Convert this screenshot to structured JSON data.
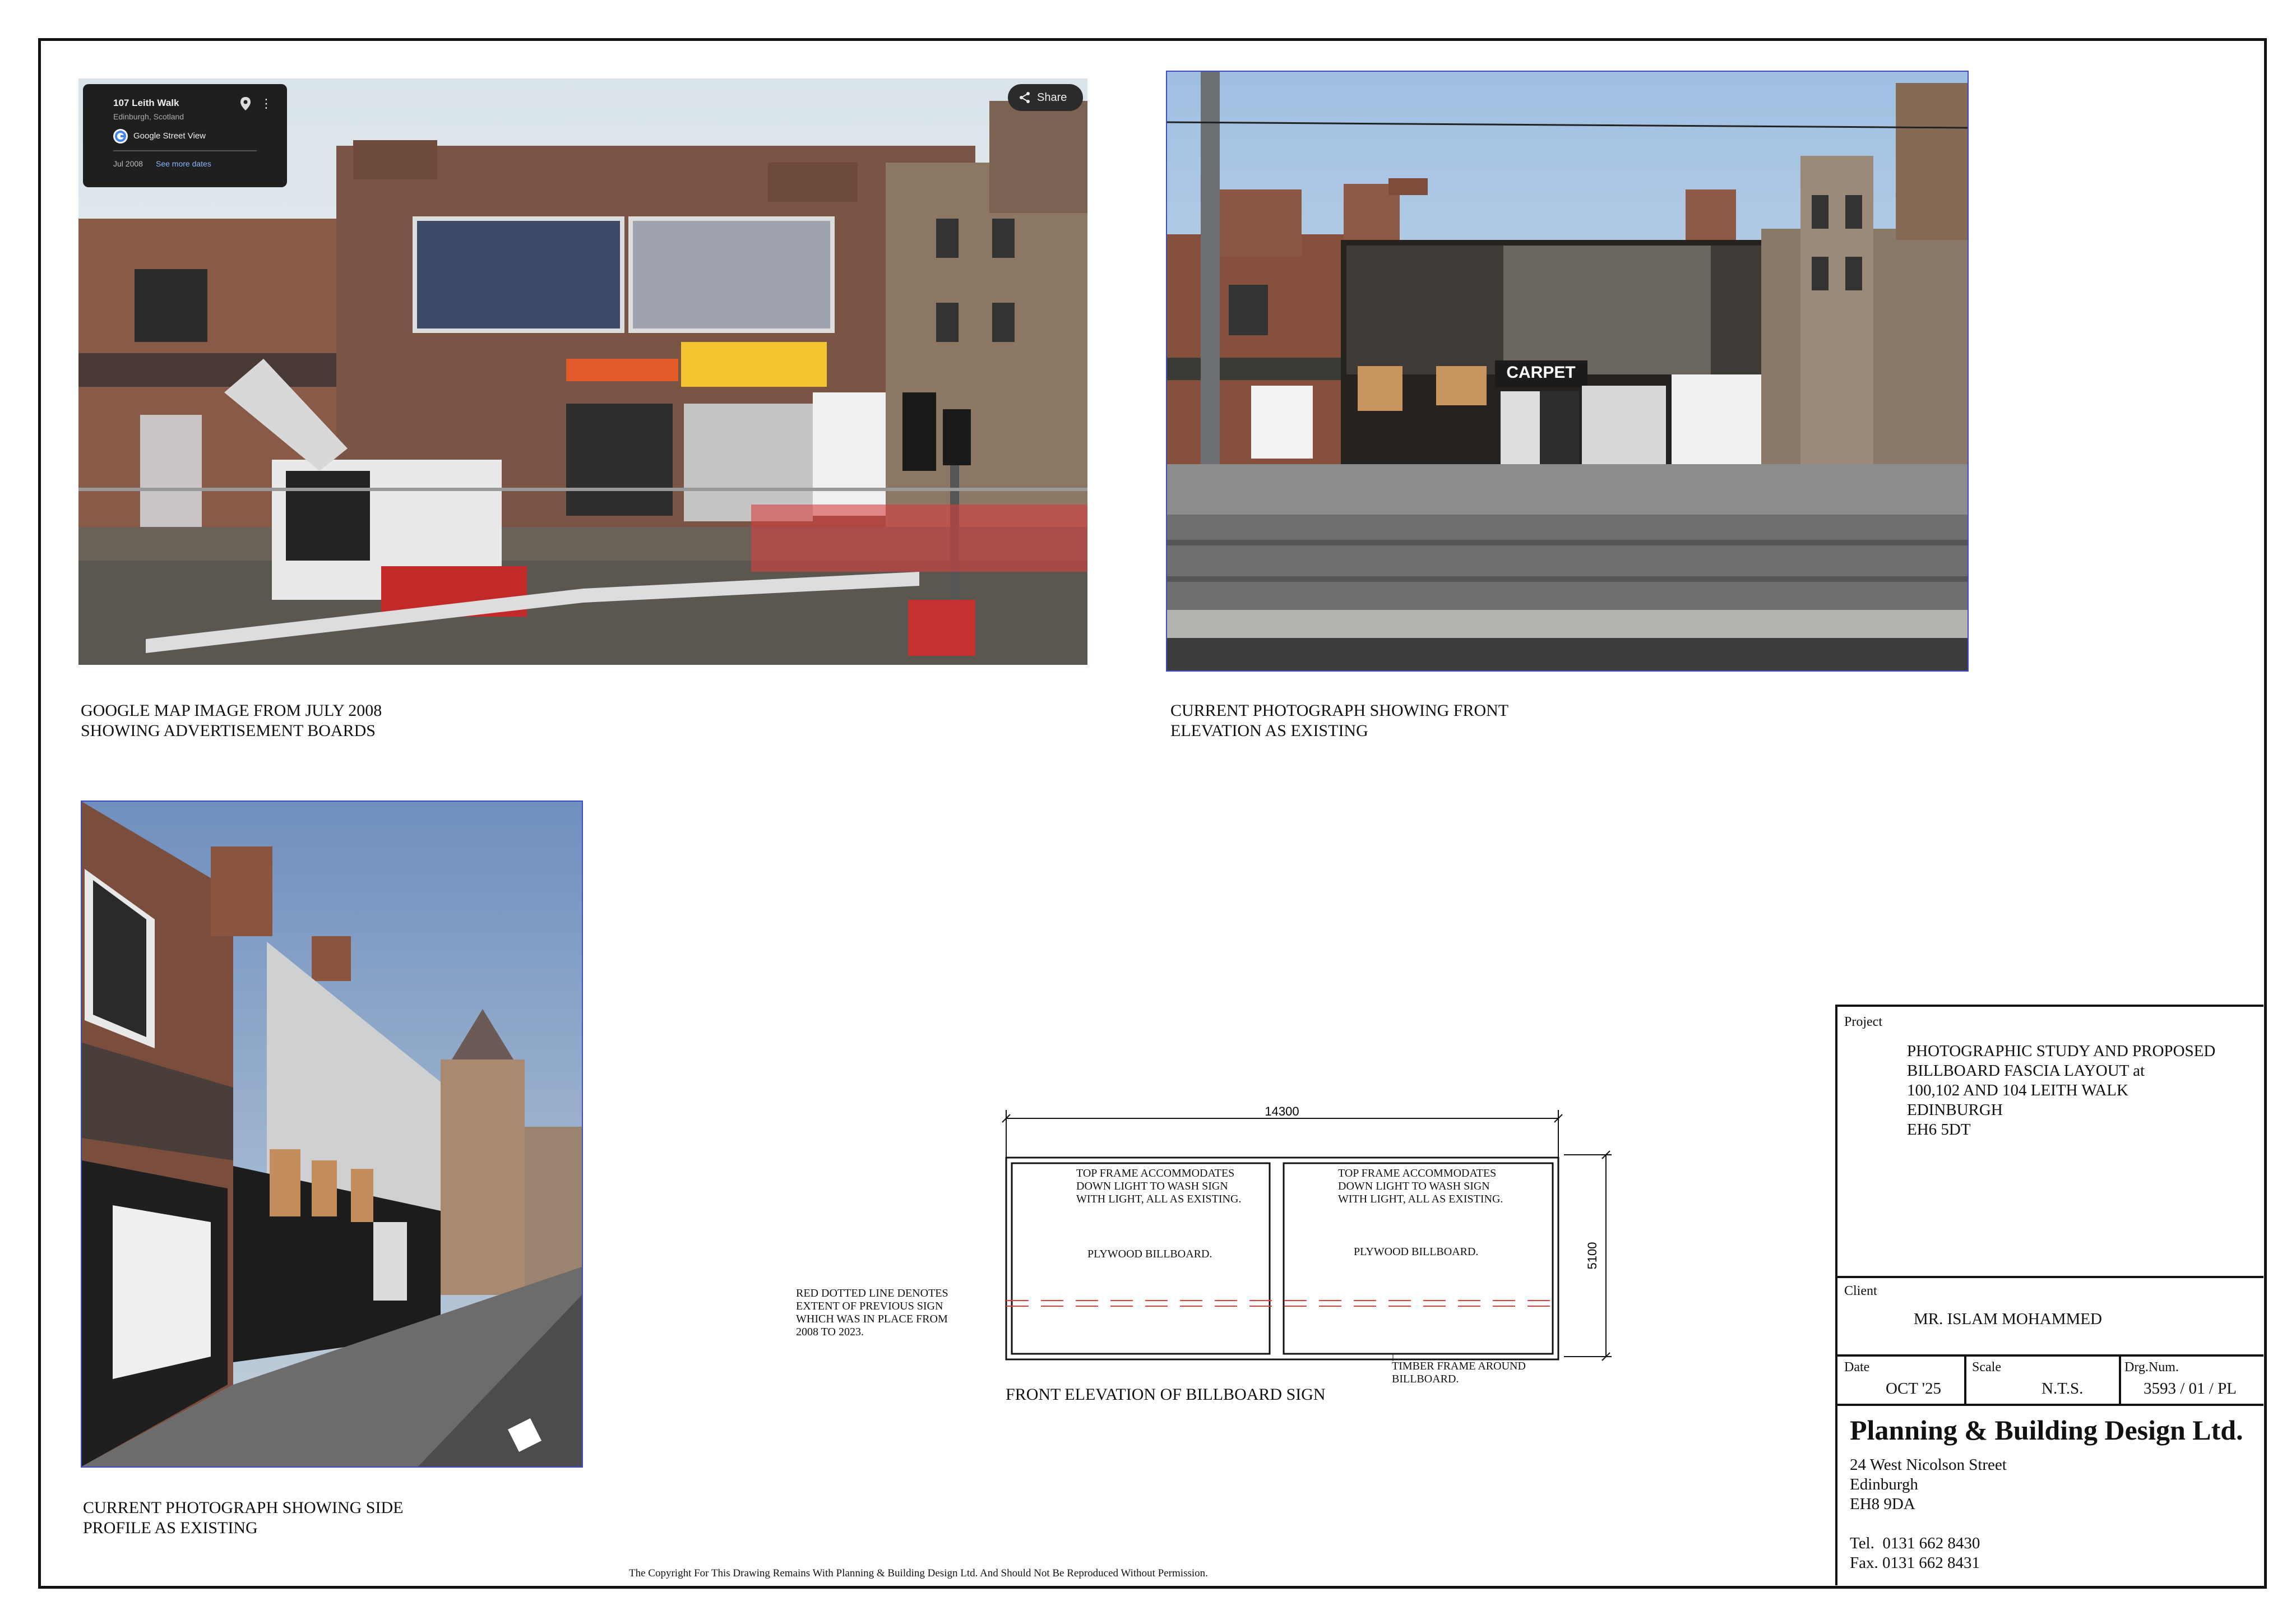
{
  "captions": {
    "google_map": "GOOGLE MAP IMAGE FROM JULY 2008\nSHOWING ADVERTISEMENT BOARDS",
    "front_photo": "CURRENT PHOTOGRAPH SHOWING FRONT\nELEVATION AS EXISTING",
    "side_photo": "CURRENT PHOTOGRAPH SHOWING SIDE\nPROFILE AS EXISTING",
    "elevation": "FRONT ELEVATION OF BILLBOARD SIGN"
  },
  "streetview_overlay": {
    "place": "107 Leith Walk",
    "subtitle": "Edinburgh, Scotland",
    "source": "Google Street View",
    "date_label": "Jul 2008",
    "see_more": "See more dates",
    "share": "Share"
  },
  "photo_signs": {
    "carpet": "CARPET"
  },
  "drawing": {
    "width_dim": "14300",
    "height_dim": "5100",
    "panel_left_note": "TOP FRAME ACCOMMODATES\nDOWN LIGHT TO WASH SIGN\nWITH LIGHT, ALL AS EXISTING.",
    "panel_right_note": "TOP FRAME ACCOMMODATES\nDOWN LIGHT TO WASH SIGN\nWITH LIGHT, ALL AS EXISTING.",
    "panel_left_label": "PLYWOOD BILLBOARD.",
    "panel_right_label": "PLYWOOD BILLBOARD.",
    "red_line_note": "RED DOTTED LINE DENOTES\nEXTENT OF PREVIOUS SIGN\nWHICH WAS IN PLACE FROM\n2008 TO 2023.",
    "timber_note": "TIMBER FRAME AROUND\nBILLBOARD.",
    "red_line_color": "#e0403c"
  },
  "title_block": {
    "project_label": "Project",
    "project": "PHOTOGRAPHIC STUDY AND PROPOSED\nBILLBOARD FASCIA LAYOUT at\n100,102 AND 104 LEITH WALK\nEDINBURGH\nEH6 5DT",
    "client_label": "Client",
    "client": "MR. ISLAM MOHAMMED",
    "date_label": "Date",
    "date": "OCT '25",
    "scale_label": "Scale",
    "scale": "N.T.S.",
    "drg_label": "Drg.Num.",
    "drg": "3593 / 01 / PL",
    "company": "Planning & Building Design Ltd.",
    "address": "24 West Nicolson Street\nEdinburgh\nEH8 9DA",
    "tel": "Tel.  0131 662 8430",
    "fax": "Fax. 0131 662 8431"
  },
  "copyright": "The Copyright For This Drawing Remains With Planning & Building Design Ltd. And Should Not Be Reproduced Without Permission."
}
